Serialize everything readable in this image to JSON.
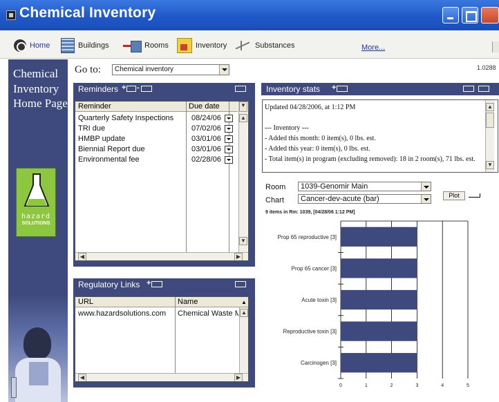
{
  "window": {
    "title": "Chemical Inventory"
  },
  "toolbar": {
    "home": "Home",
    "buildings": "Buildings",
    "rooms": "Rooms",
    "inventory": "Inventory",
    "substances": "Substances",
    "more": "More..."
  },
  "nav": {
    "page_title": "Chemical Inventory Home Page",
    "logo_line1": "hazard",
    "logo_line2": "SOLUTIONS"
  },
  "goto": {
    "label": "Go to:",
    "selected": "Chemical inventory"
  },
  "version": "1.0288",
  "reminders": {
    "title": "Reminders",
    "col_reminder": "Reminder",
    "col_due": "Due date",
    "items": [
      {
        "name": "Quarterly Safety Inspections",
        "due": "08/24/06"
      },
      {
        "name": "TRI due",
        "due": "07/02/06"
      },
      {
        "name": "HMBP update",
        "due": "03/01/06"
      },
      {
        "name": "Biennial Report due",
        "due": "03/01/06"
      },
      {
        "name": "Environmental fee",
        "due": "02/28/06"
      }
    ]
  },
  "regulatory": {
    "title": "Regulatory Links",
    "col_url": "URL",
    "col_name": "Name",
    "rows": [
      {
        "url": "www.hazardsolutions.com",
        "name": "Chemical Waste Ma"
      }
    ]
  },
  "stats": {
    "title": "Inventory stats",
    "lines": [
      "Updated 04/28/2006, at 1:12 PM",
      "",
      "--- Inventory ---",
      "- Added this month: 0 item(s), 0 lbs. est.",
      "- Added this year: 0 item(s), 0 lbs. est.",
      "- Total item(s) in program (excluding removed): 18 in 2 room(s), 71 lbs. est."
    ],
    "room_label": "Room",
    "room_value": "1039-Genomir Main",
    "chart_label": "Chart",
    "chart_value": "Cancer-dev-acute (bar)",
    "plot_button": "Plot",
    "chart_caption": "9 items in Rm: 1039, [04/28/06 1:12 PM]"
  },
  "chart_data": {
    "type": "bar",
    "orientation": "horizontal",
    "categories": [
      "Prop 65 reproductive [3]",
      "Prop 65 cancer [3]",
      "Acute toxin [3]",
      "Reproductive toxin [3]",
      "Carcinogen [3]"
    ],
    "values": [
      3,
      3,
      3,
      3,
      3
    ],
    "xlim": [
      0,
      5
    ],
    "xticks": [
      0,
      1,
      2,
      3,
      4,
      5
    ],
    "grid": true,
    "bar_color": "#3e4a7e"
  }
}
